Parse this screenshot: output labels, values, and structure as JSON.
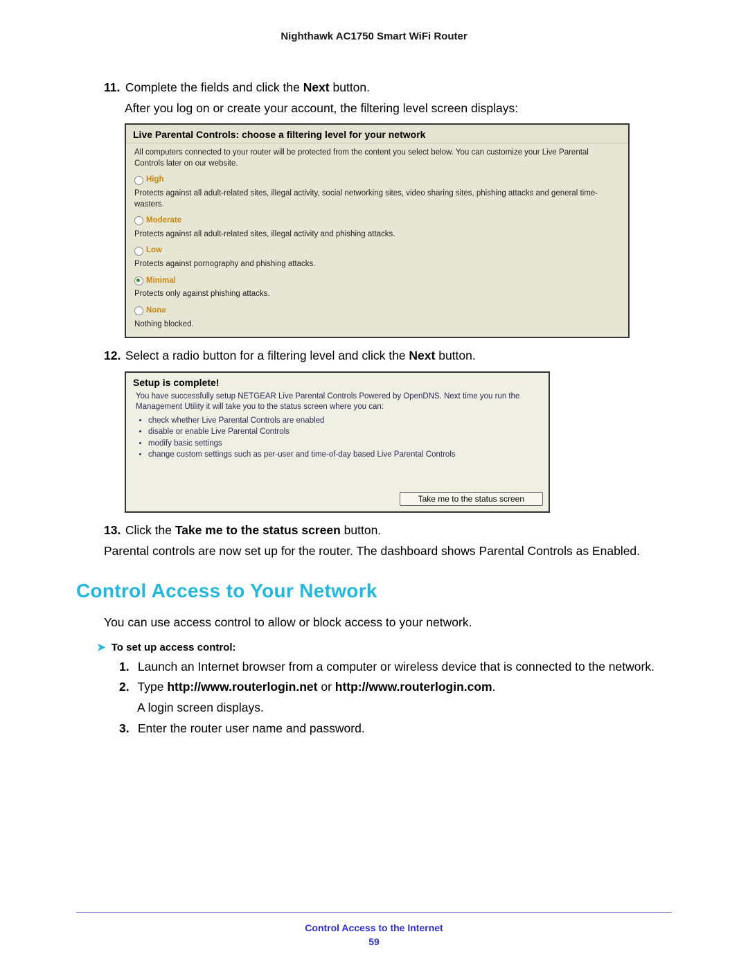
{
  "header": {
    "product": "Nighthawk AC1750 Smart WiFi Router"
  },
  "steps": {
    "s11": {
      "num": "11.",
      "text_a": "Complete the fields and click the ",
      "bold": "Next",
      "text_b": " button.",
      "after": "After you log on or create your account, the filtering level screen displays:"
    },
    "s12": {
      "num": "12.",
      "text_a": "Select a radio button for a filtering level and click the ",
      "bold": "Next",
      "text_b": " button."
    },
    "s13": {
      "num": "13.",
      "text_a": "Click the ",
      "bold": "Take me to the status screen",
      "text_b": " button.",
      "after": "Parental controls are now set up for the router. The dashboard shows Parental Controls as Enabled."
    }
  },
  "panel1": {
    "title": "Live Parental Controls: choose a filtering level for your network",
    "intro": "All computers connected to your router will be protected from the content you select below.  You can customize your Live Parental Controls later on our website.",
    "options": {
      "high": {
        "label": "High",
        "desc": "Protects against all adult-related sites, illegal activity, social networking sites, video sharing sites, phishing attacks and general time-wasters."
      },
      "moderate": {
        "label": "Moderate",
        "desc": "Protects against all adult-related sites, illegal activity and phishing attacks."
      },
      "low": {
        "label": "Low",
        "desc": "Protects against pornography and phishing attacks."
      },
      "minimal": {
        "label": "Minimal",
        "desc": "Protects only against phishing attacks."
      },
      "none": {
        "label": "None",
        "desc": "Nothing blocked."
      }
    }
  },
  "panel2": {
    "title": "Setup is complete!",
    "intro": "You have successfully setup NETGEAR Live Parental Controls Powered by OpenDNS.  Next time you run the Management Utility it will take you to the status screen where you can:",
    "bullets": [
      "check whether Live Parental Controls are enabled",
      "disable or enable Live Parental Controls",
      "modify basic settings",
      "change custom settings such as per-user and time-of-day based Live Parental Controls"
    ],
    "button": "Take me to the status screen"
  },
  "section": {
    "title": "Control Access to Your Network",
    "intro": "You can use access control to allow or block access to your network.",
    "task_chevron": "➤",
    "task_label": "To set up access control:",
    "sub": {
      "s1": {
        "num": "1.",
        "text": "Launch an Internet browser from a computer or wireless device that is connected to the network."
      },
      "s2": {
        "num": "2.",
        "pre": "Type ",
        "b1": "http://www.routerlogin.net",
        "mid": " or ",
        "b2": "http://www.routerlogin.com",
        "post": ".",
        "after": "A login screen displays."
      },
      "s3": {
        "num": "3.",
        "text": "Enter the router user name and password."
      }
    }
  },
  "footer": {
    "section": "Control Access to the Internet",
    "page": "59"
  }
}
